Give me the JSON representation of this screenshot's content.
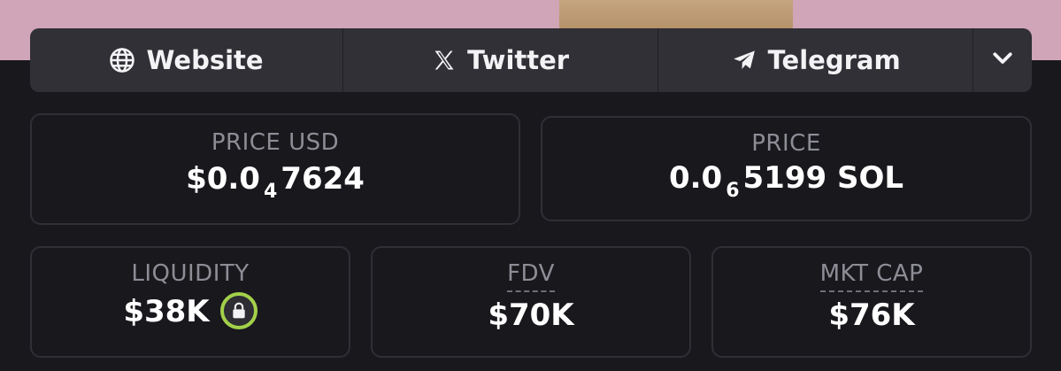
{
  "links": {
    "website": "Website",
    "twitter": "Twitter",
    "telegram": "Telegram"
  },
  "stats": {
    "price_usd": {
      "label": "PRICE USD",
      "prefix": "$0.0",
      "sub": "4",
      "rest": "7624"
    },
    "price": {
      "label": "PRICE",
      "prefix": "0.0",
      "sub": "6",
      "rest": "5199 SOL"
    },
    "liquidity": {
      "label": "LIQUIDITY",
      "value": "$38K"
    },
    "fdv": {
      "label": "FDV",
      "value": "$70K"
    },
    "mkt_cap": {
      "label": "MKT CAP",
      "value": "$76K"
    }
  },
  "colors": {
    "banner": "#cfa5b7",
    "background": "#19181d",
    "lock_ring": "#a3d14a"
  },
  "icons": [
    "globe-icon",
    "x-logo-icon",
    "telegram-icon",
    "chevron-down-icon",
    "lock-icon"
  ]
}
